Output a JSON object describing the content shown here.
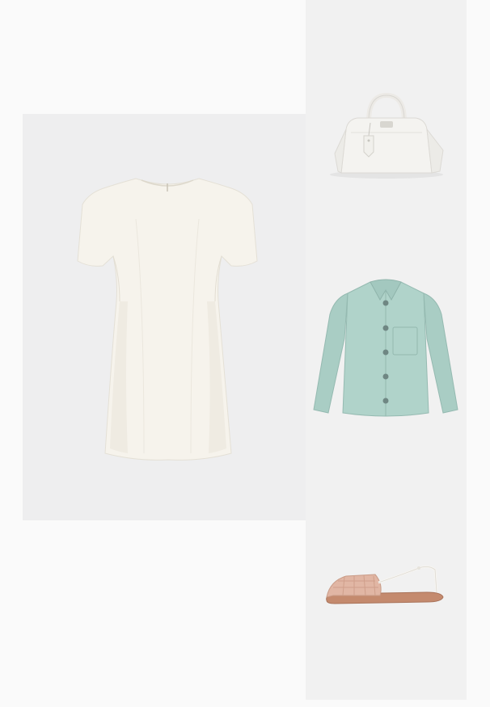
{
  "products": [
    {
      "item": "dress",
      "color": "#f6f3ec"
    },
    {
      "item": "handbag",
      "color": "#f4f3f0"
    },
    {
      "item": "jacket",
      "color": "#a9cdc4"
    },
    {
      "item": "sandal",
      "color": "#e1b6a4"
    }
  ]
}
